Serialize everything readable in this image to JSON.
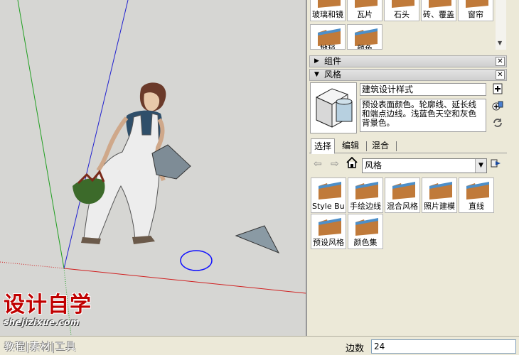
{
  "materials": {
    "tiles": [
      {
        "label": "玻璃和镜"
      },
      {
        "label": "瓦片"
      },
      {
        "label": "石头"
      },
      {
        "label": "砖、覆盖"
      },
      {
        "label": "窗帘"
      },
      {
        "label": "地毯"
      },
      {
        "label": "颜色"
      }
    ]
  },
  "components_section": {
    "title": "组件",
    "collapsed": true
  },
  "styles_section": {
    "title": "风格",
    "style_name": "建筑设计样式",
    "style_description": "预设表面颜色。轮廓线、延长线和端点边线。浅蓝色天空和灰色背景色。",
    "tabs": [
      {
        "label": "选择",
        "active": true
      },
      {
        "label": "编辑",
        "active": false
      },
      {
        "label": "混合",
        "active": false
      }
    ],
    "collection": "风格",
    "tiles": [
      {
        "label": "Style Builder"
      },
      {
        "label": "手绘边线"
      },
      {
        "label": "混合风格"
      },
      {
        "label": "照片建模"
      },
      {
        "label": "直线"
      },
      {
        "label": "预设风格"
      },
      {
        "label": "颜色集"
      }
    ]
  },
  "statusbar": {
    "measurement_label": "边数",
    "measurement_value": "24"
  },
  "watermark": {
    "logo": "设计自学",
    "url": "shejizixue.com",
    "tags": "教程|素材|工具"
  },
  "icons": {
    "back": "arrow-left-icon",
    "forward": "arrow-right-icon",
    "home": "home-icon",
    "details": "details-arrow-icon",
    "close": "close-icon"
  }
}
